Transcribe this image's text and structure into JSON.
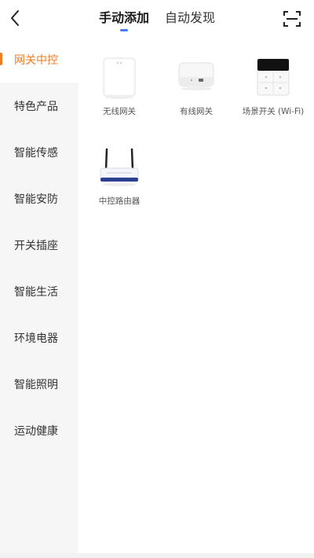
{
  "header": {
    "tabs": [
      {
        "label": "手动添加",
        "active": true
      },
      {
        "label": "自动发现",
        "active": false
      }
    ],
    "back_icon": "chevron-left-icon",
    "scan_icon": "scan-icon",
    "accent_color": "#4a7cf6"
  },
  "sidebar": {
    "active_color": "#f47a20",
    "items": [
      {
        "label": "网关中控",
        "active": true
      },
      {
        "label": "特色产品",
        "active": false
      },
      {
        "label": "智能传感",
        "active": false
      },
      {
        "label": "智能安防",
        "active": false
      },
      {
        "label": "开关插座",
        "active": false
      },
      {
        "label": "智能生活",
        "active": false
      },
      {
        "label": "环境电器",
        "active": false
      },
      {
        "label": "智能照明",
        "active": false
      },
      {
        "label": "运动健康",
        "active": false
      }
    ]
  },
  "products": [
    {
      "label": "无线网关",
      "icon": "wireless-gateway"
    },
    {
      "label": "有线网关",
      "icon": "wired-gateway"
    },
    {
      "label": "场景开关 (Wi-Fi)",
      "icon": "scene-switch"
    },
    {
      "label": "中控路由器",
      "icon": "router"
    }
  ]
}
